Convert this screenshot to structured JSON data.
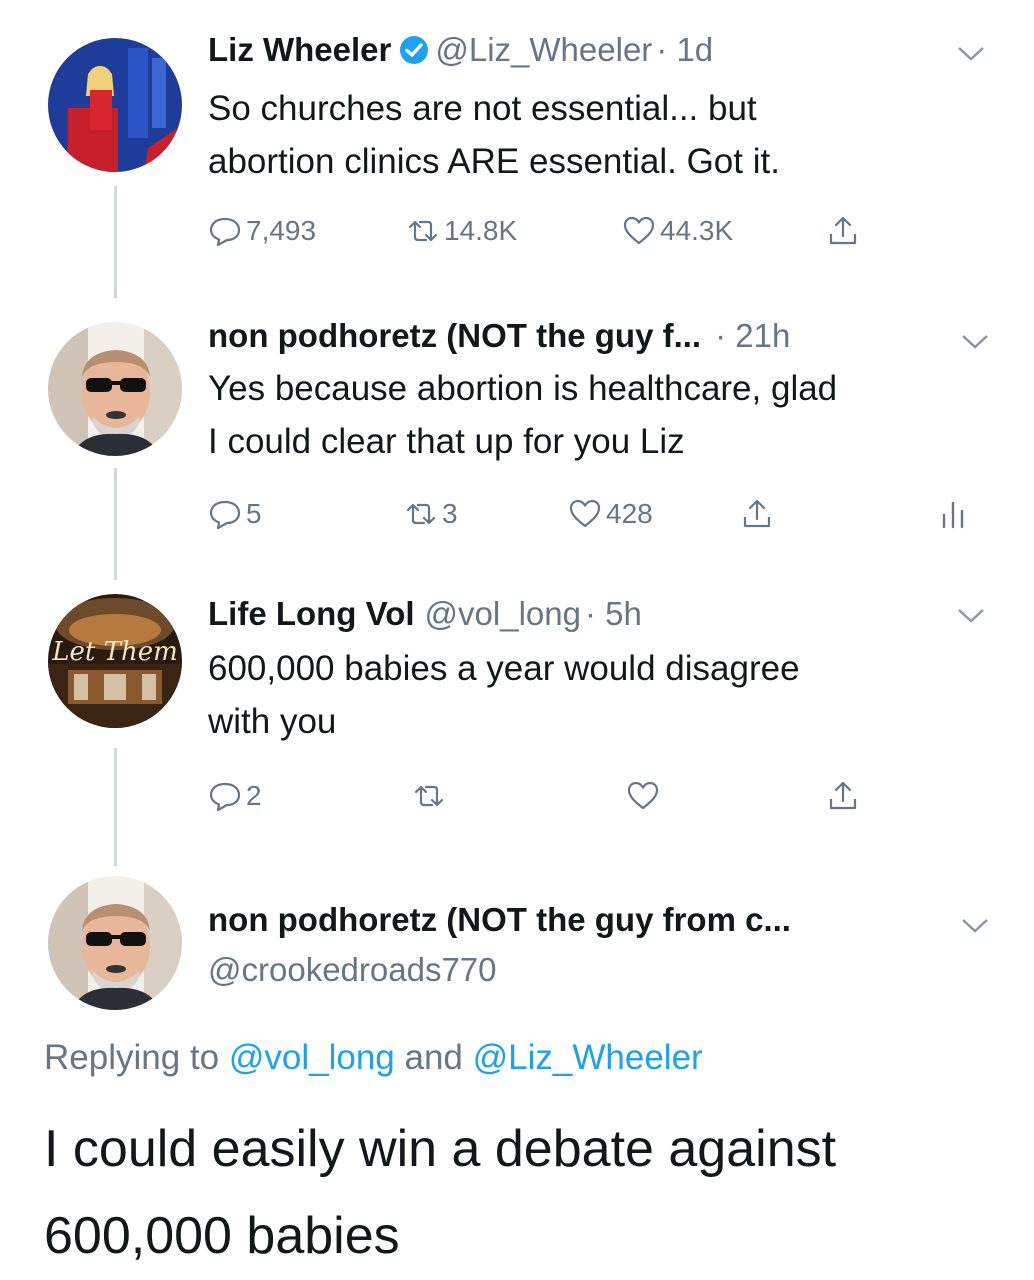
{
  "tweets": [
    {
      "name": "Liz Wheeler",
      "handle": "@Liz_Wheeler",
      "time": "· 1d",
      "text_lines": [
        "So churches are not essential... but",
        "abortion clinics ARE essential. Got it."
      ],
      "replies": "7,493",
      "retweets": "14.8K",
      "likes": "44.3K"
    },
    {
      "name": "non podhoretz (NOT the guy f...",
      "time": "· 21h",
      "text_lines": [
        "Yes because abortion is healthcare, glad",
        "I could clear that up for you Liz"
      ],
      "replies": "5",
      "retweets": "3",
      "likes": "428"
    },
    {
      "name": "Life Long Vol",
      "handle": "@vol_long",
      "time": "· 5h",
      "text_lines": [
        "600,000 babies a year would disagree",
        "with you"
      ],
      "replies": "2",
      "avatar_text": "Let Them"
    }
  ],
  "main_tweet": {
    "name": "non podhoretz (NOT the guy from c...",
    "handle": "@crookedroads770",
    "replying_prefix": "Replying to",
    "replying_user1": "@vol_long",
    "replying_and": "and",
    "replying_user2": "@Liz_Wheeler",
    "text_lines": [
      "I could easily win a debate against",
      "600,000 babies"
    ]
  },
  "icons": [
    "reply-icon",
    "retweet-icon",
    "like-icon",
    "share-icon",
    "verified-badge-icon",
    "chevron-down-icon",
    "analytics-icon"
  ],
  "colors": {
    "text": "#14171a",
    "secondary": "#657786",
    "link": "#1da1f2",
    "verified": "#1da1f2",
    "thread_line": "#cfd9de"
  }
}
